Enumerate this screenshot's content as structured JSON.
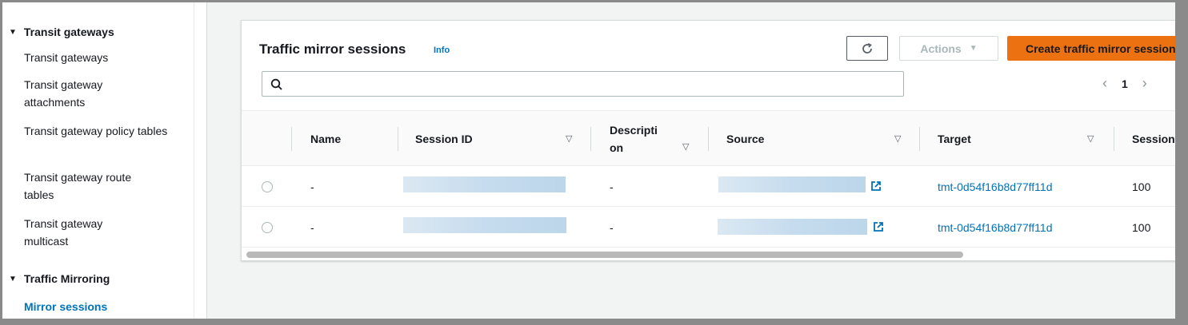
{
  "sidebar": {
    "sections": [
      {
        "label": "Transit gateways",
        "items": [
          "Transit gateways",
          "Transit gateway attachments",
          "Transit gateway policy tables",
          "Transit gateway route tables",
          "Transit gateway multicast"
        ]
      },
      {
        "label": "Traffic Mirroring",
        "items": [
          "Mirror sessions"
        ]
      }
    ],
    "active_item": "Mirror sessions"
  },
  "panel": {
    "title": "Traffic mirror sessions",
    "info_label": "Info",
    "actions_label": "Actions",
    "create_label": "Create traffic mirror session",
    "search": {
      "value": "",
      "placeholder": ""
    },
    "pagination": {
      "current_page": "1"
    }
  },
  "table": {
    "columns": [
      "Name",
      "Session ID",
      "Description",
      "Source",
      "Target",
      "Session"
    ],
    "rows": [
      {
        "name": "-",
        "session_id": "",
        "description": "-",
        "source": "",
        "target": "tmt-0d54f16b8d77ff11d",
        "session": "100"
      },
      {
        "name": "-",
        "session_id": "",
        "description": "-",
        "source": "",
        "target": "tmt-0d54f16b8d77ff11d",
        "session": "100"
      }
    ]
  },
  "colors": {
    "accent_link": "#0073bb",
    "primary_button": "#ec7211",
    "redacted_fill": "#c6dcee"
  },
  "icons": [
    "triangle-down-icon",
    "refresh-icon",
    "caret-down-icon",
    "search-icon",
    "chevron-left-icon",
    "chevron-right-icon",
    "external-link-icon",
    "sort-icon"
  ]
}
